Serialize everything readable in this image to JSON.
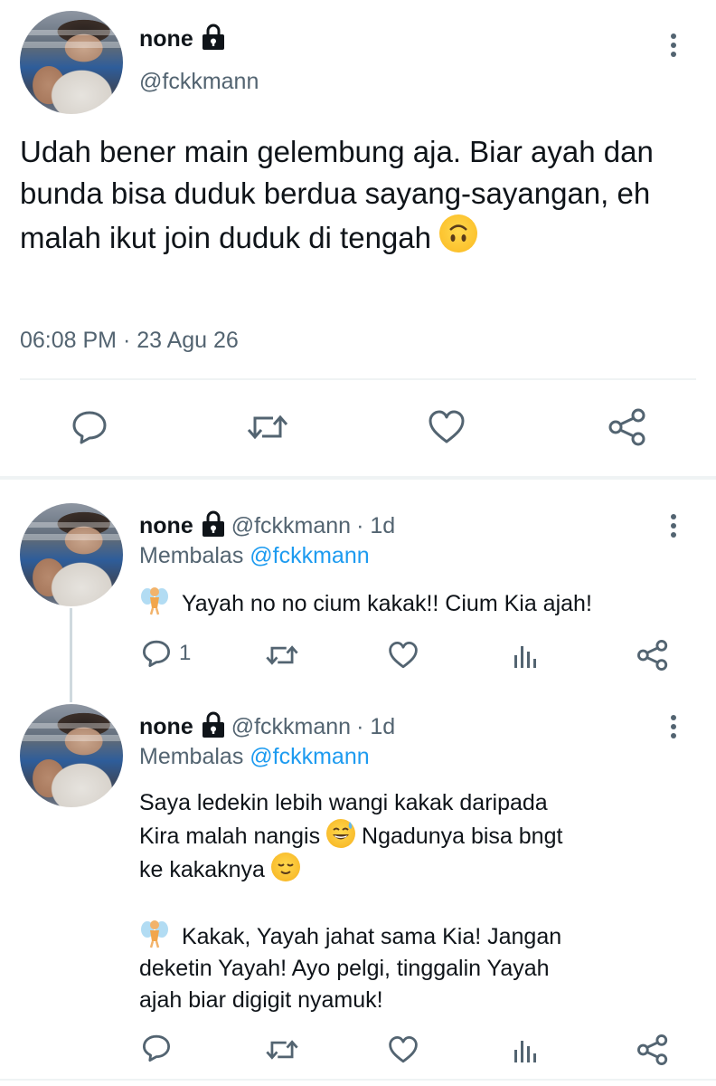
{
  "colors": {
    "accent": "#1d9bf0",
    "muted": "#536471",
    "text": "#0f1419",
    "divider": "#eff3f4"
  },
  "main_tweet": {
    "name": "none",
    "handle": "@fckkmann",
    "text": "Udah bener main gelembung aja. Biar ayah dan bunda bisa duduk berdua sayang-sayangan, eh malah ikut join duduk di tengah",
    "text_emoji": "upside-down-face",
    "timestamp": "06:08 PM · 23 Agu 26",
    "actions": [
      "reply-icon",
      "retweet-icon",
      "like-icon",
      "share-icon"
    ]
  },
  "replies": [
    {
      "name": "none",
      "handle": "@fckkmann",
      "time": "· 1d",
      "replying_label": "Membalas",
      "replying_to": "@fckkmann",
      "lines": [
        "Yayah no no cium kakak!! Cium Kia ajah!"
      ],
      "lead_emoji": "fairy",
      "reply_count": "1",
      "actions": [
        "reply-icon",
        "retweet-icon",
        "like-icon",
        "analytics-icon",
        "share-icon"
      ]
    },
    {
      "name": "none",
      "handle": "@fckkmann",
      "time": "· 1d",
      "replying_label": "Membalas",
      "replying_to": "@fckkmann",
      "paragraph1": {
        "line1": "Saya ledekin lebih wangi kakak daripada",
        "line2a": "Kira malah nangis",
        "line2_emoji": "grinning-sweat",
        "line2b": "Ngadunya bisa bngt",
        "line3a": "ke kakaknya",
        "line3_emoji": "relieved-face"
      },
      "paragraph2": {
        "lead_emoji": "fairy",
        "line1": "Kakak, Yayah jahat sama Kia! Jangan",
        "line2": "deketin Yayah! Ayo pelgi, tinggalin Yayah",
        "line3": "ajah biar digigit nyamuk!"
      },
      "actions": [
        "reply-icon",
        "retweet-icon",
        "like-icon",
        "analytics-icon",
        "share-icon"
      ]
    }
  ]
}
